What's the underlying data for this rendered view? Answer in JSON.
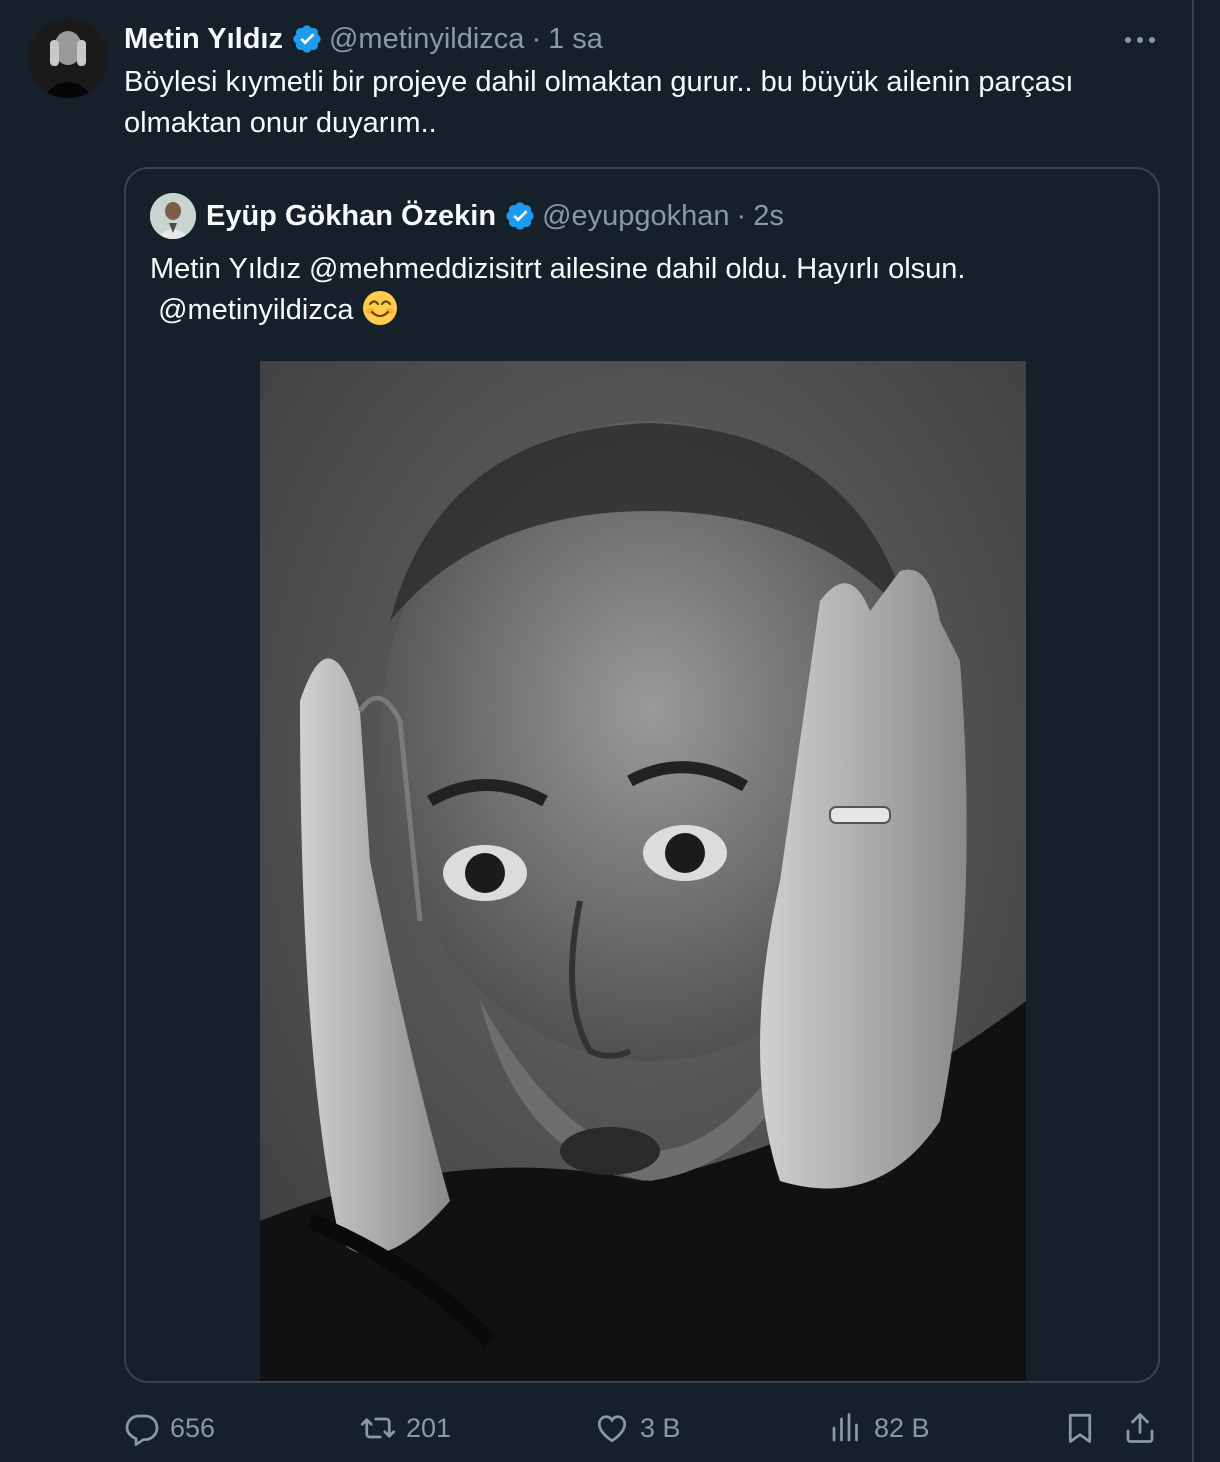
{
  "tweet": {
    "author": {
      "display_name": "Metin Yıldız",
      "handle": "@metinyildizca",
      "verified_icon": "verified-badge-icon"
    },
    "separator": "·",
    "time": "1 sa",
    "text": "Böylesi kıymetli bir projeye dahil olmaktan gurur.. bu büyük ailenin parçası olmaktan onur duyarım.."
  },
  "quoted_tweet": {
    "author": {
      "display_name": "Eyüp Gökhan Özekin",
      "handle": "@eyupgokhan",
      "verified_icon": "verified-badge-icon"
    },
    "separator": "·",
    "time": "2s",
    "text_line1": "Metin Yıldız @mehmeddizisitrt ailesine dahil oldu. Hayırlı olsun.",
    "text_mention": "@metinyildizca",
    "emoji": "😊"
  },
  "actions": {
    "replies": "656",
    "reposts": "201",
    "likes": "3 B",
    "views": "82 B"
  },
  "colors": {
    "background": "#15202b",
    "text_primary": "#f7f9f9",
    "text_secondary": "#8b98a5",
    "border": "#38444d",
    "verified": "#1d9bf0"
  }
}
